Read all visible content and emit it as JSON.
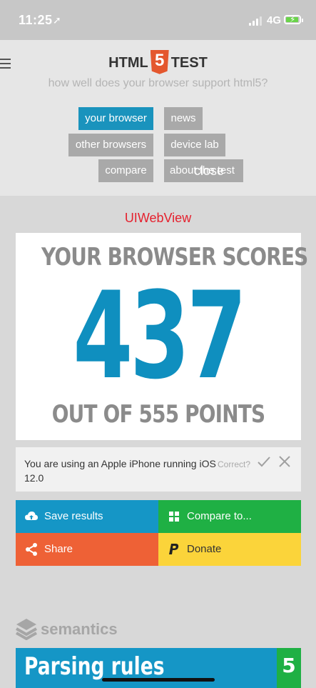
{
  "status_bar": {
    "time": "11:25",
    "network": "4G"
  },
  "header": {
    "logo_left": "HTML",
    "logo_mid": "5",
    "logo_right": "TEST",
    "tagline": "how well does your browser support html5?",
    "nav": {
      "your_browser": "your browser",
      "news": "news",
      "other_browsers": "other browsers",
      "device_lab": "device lab",
      "compare": "compare",
      "about_the_test": "about the test",
      "close_overlay": "close"
    }
  },
  "title": "UIWebView",
  "score": {
    "top_text": "YOUR BROWSER SCORES",
    "value": "437",
    "bottom_text": "OUT OF 555 POINTS"
  },
  "device_info": {
    "text": "You are using an Apple iPhone running iOS 12.0",
    "correct_label": "Correct?"
  },
  "actions": {
    "save": "Save results",
    "compare": "Compare to...",
    "share": "Share",
    "donate": "Donate"
  },
  "section": {
    "label": "semantics",
    "item_label": "Parsing rules",
    "item_score": "5"
  },
  "colors": {
    "blue": "#1596c6",
    "green": "#1fb044",
    "orange": "#ee6136",
    "yellow": "#fbd43a",
    "red_title": "#e5202d",
    "nav_gray": "#a9a9a9"
  }
}
